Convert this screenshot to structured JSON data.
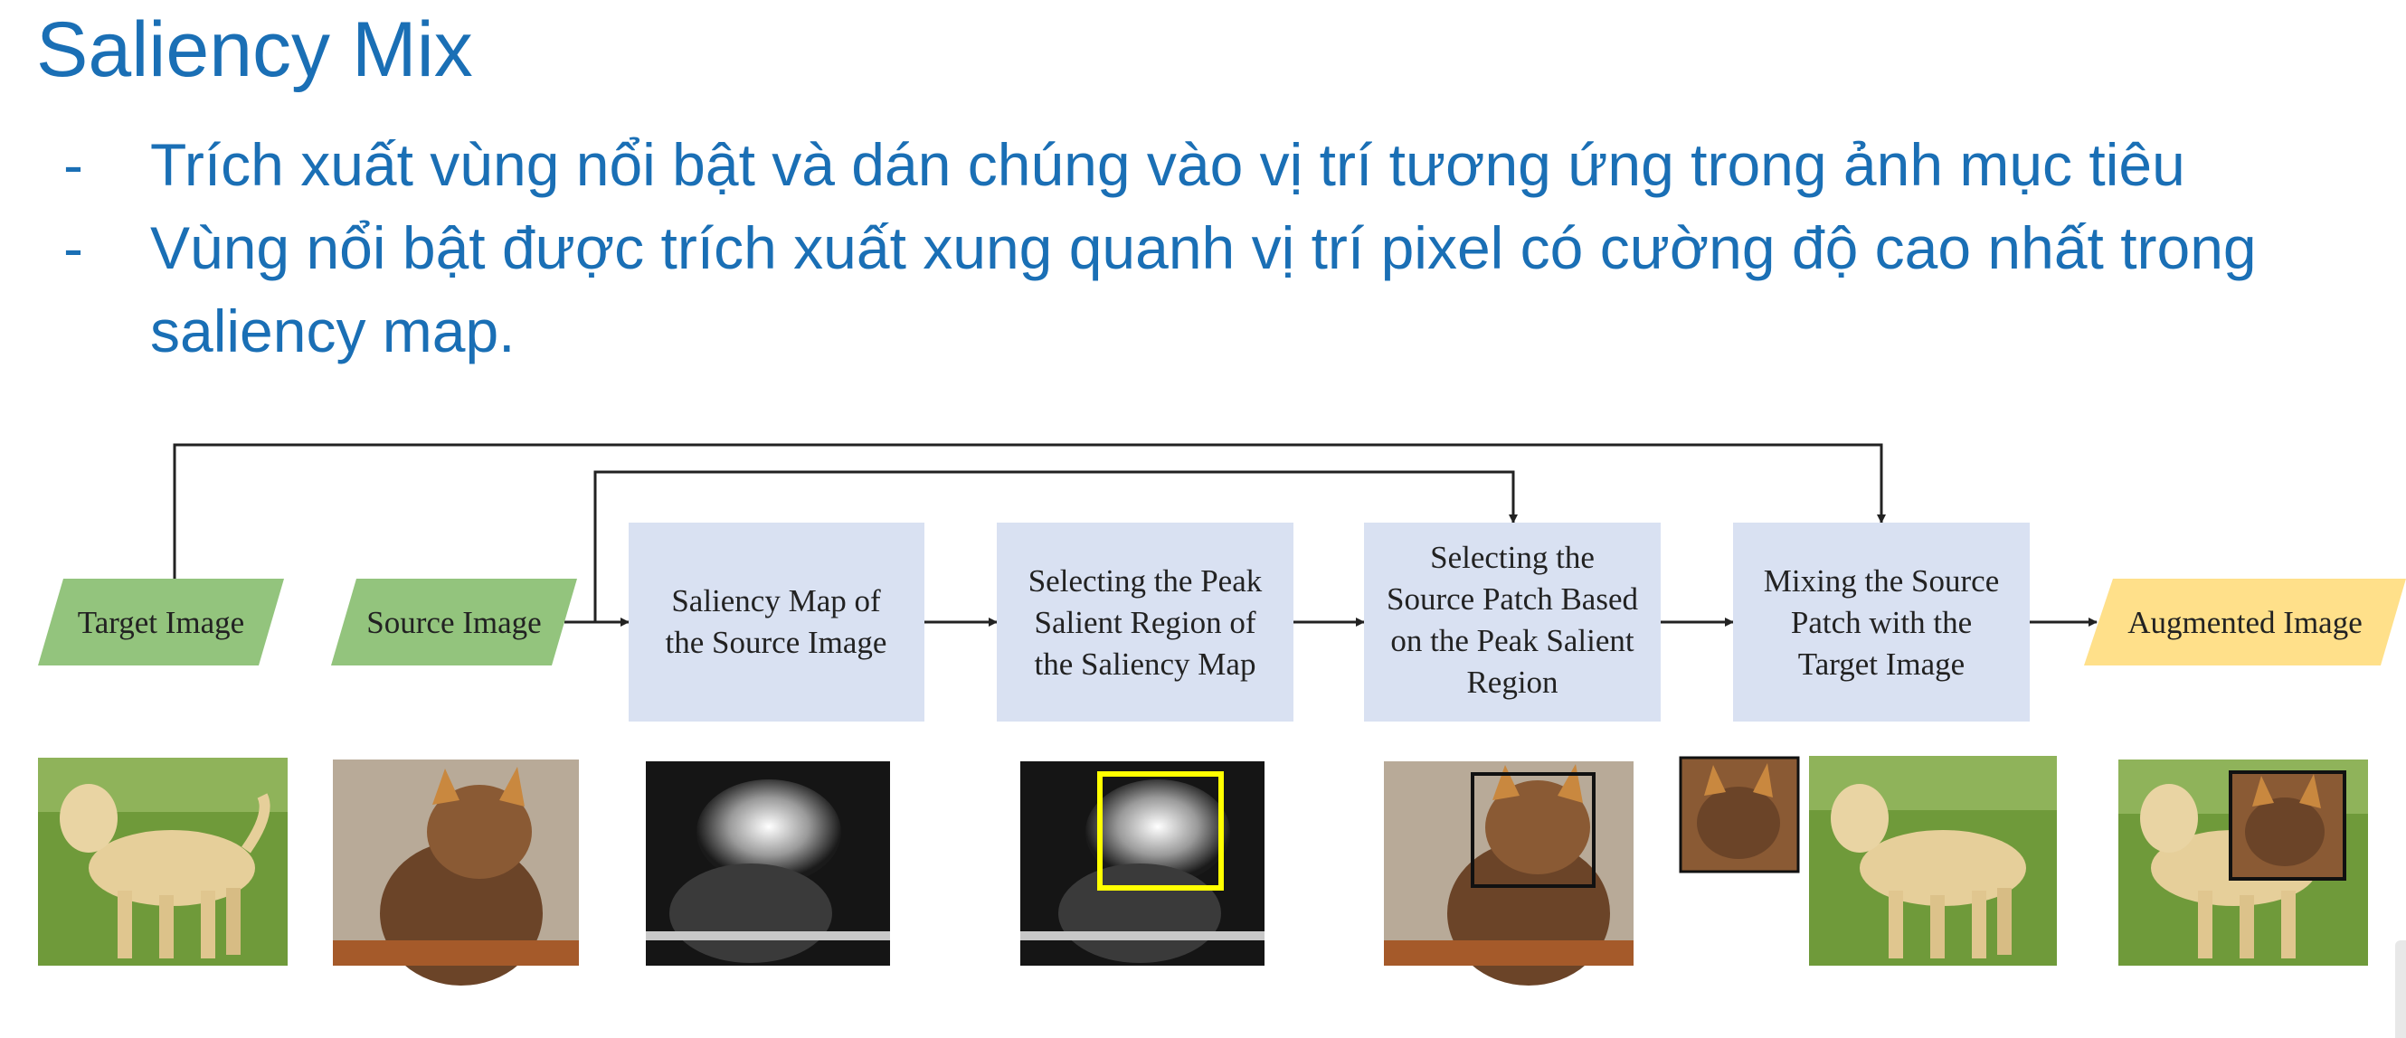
{
  "slide": {
    "title": "Saliency Mix",
    "bullets": [
      {
        "marker": "-",
        "lines": [
          "Trích xuất vùng nổi bật và dán chúng vào vị trí tương ứng trong ảnh mục tiêu"
        ]
      },
      {
        "marker": "-",
        "lines": [
          "Vùng nổi bật được trích xuất xung quanh vị trí pixel có cường độ cao nhất trong",
          "saliency map."
        ]
      }
    ]
  },
  "colors": {
    "title": "#1a6fb5",
    "input_box": "#93c47d",
    "process_box": "#d9e1f2",
    "output_box": "#ffe08a",
    "highlight_box": "#ffff00",
    "arrow": "#222222"
  },
  "diagram": {
    "inputs": [
      {
        "id": "target",
        "label": "Target Image"
      },
      {
        "id": "source",
        "label": "Source Image"
      }
    ],
    "steps": [
      {
        "id": "saliency",
        "lines": [
          "Saliency  Map of",
          "the Source Image"
        ]
      },
      {
        "id": "peak",
        "lines": [
          "Selecting the Peak",
          "Salient Region of",
          "the Saliency Map"
        ]
      },
      {
        "id": "patch",
        "lines": [
          "Selecting the",
          "Source Patch Based",
          "on the Peak Salient",
          "Region"
        ]
      },
      {
        "id": "mix",
        "lines": [
          "Mixing the Source",
          "Patch with the",
          "Target Image"
        ]
      }
    ],
    "output": {
      "id": "augmented",
      "label": "Augmented Image"
    },
    "thumbnails": [
      {
        "id": "target-photo",
        "icon": "dog-photo"
      },
      {
        "id": "source-photo",
        "icon": "cat-photo"
      },
      {
        "id": "saliency-map",
        "icon": "saliency-map-image"
      },
      {
        "id": "peak-region",
        "icon": "saliency-map-with-peak-box"
      },
      {
        "id": "source-patch",
        "icon": "cat-photo-with-patch-box"
      },
      {
        "id": "cropped-patch",
        "icon": "cat-patch"
      },
      {
        "id": "mix-target",
        "icon": "dog-photo"
      },
      {
        "id": "augmented-photo",
        "icon": "dog-with-cat-patch"
      }
    ]
  }
}
